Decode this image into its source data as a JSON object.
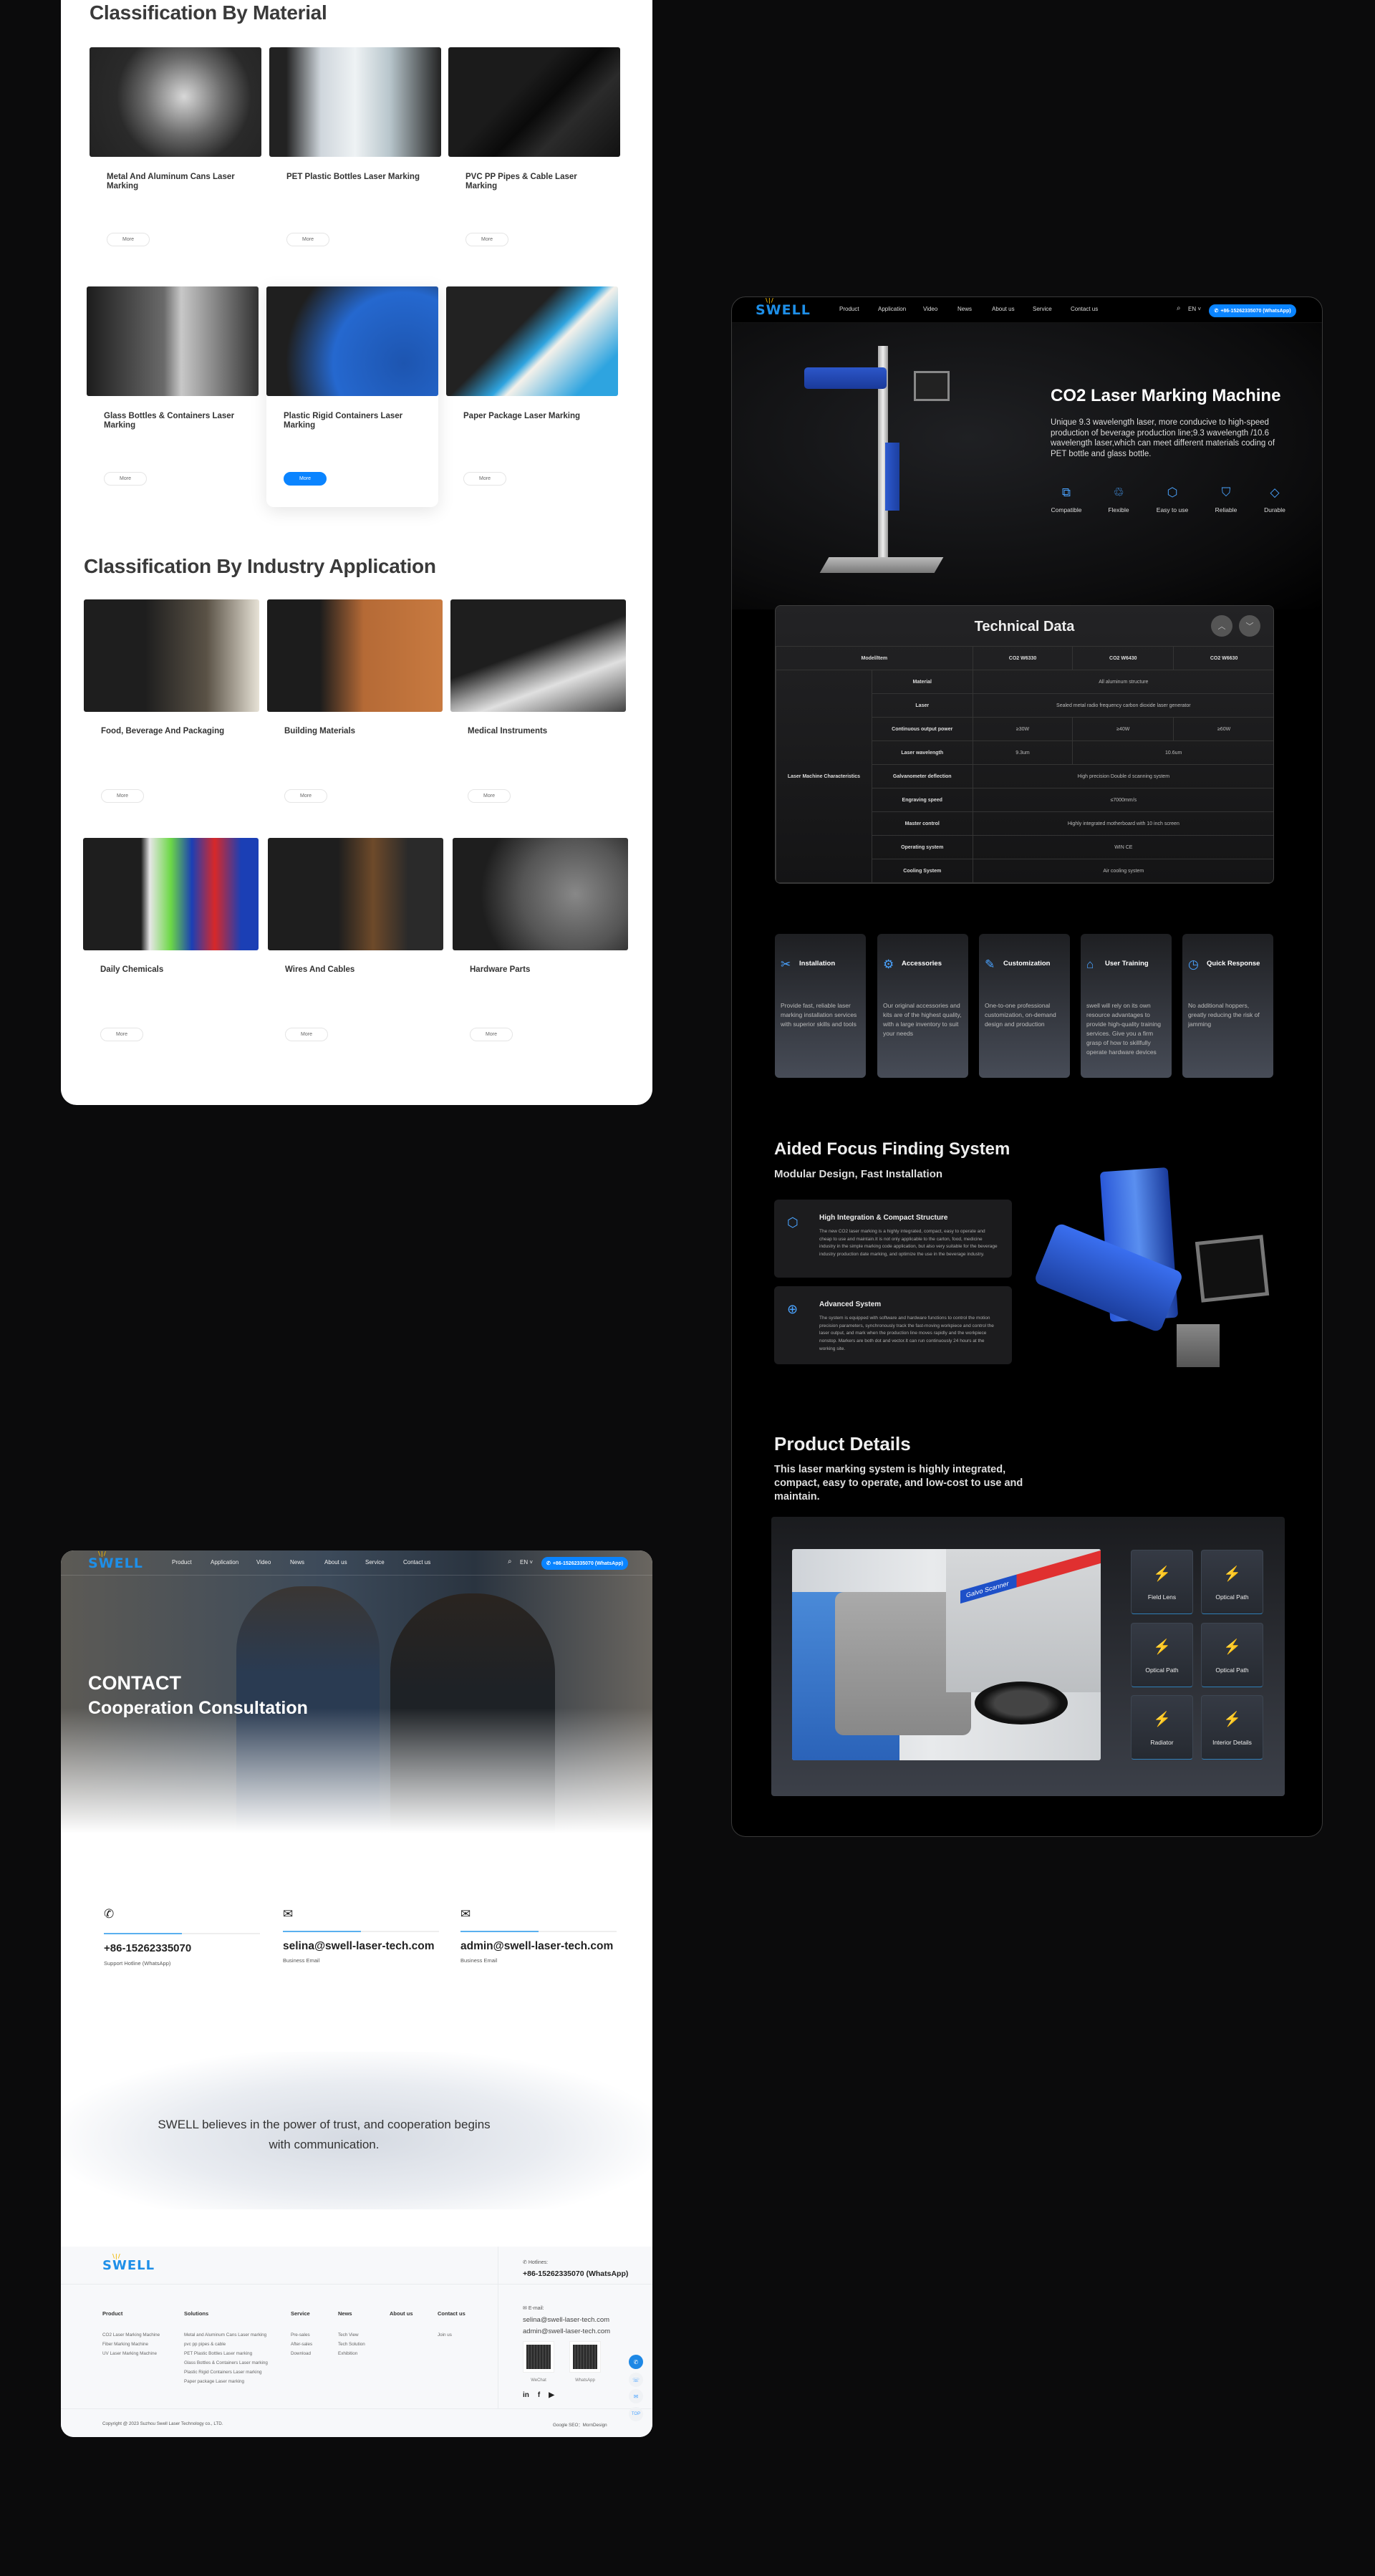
{
  "material": {
    "title": "Classification By Material",
    "cards": [
      {
        "title": "Metal And Aluminum Cans Laser Marking",
        "more": "More"
      },
      {
        "title": "PET Plastic Bottles Laser Marking",
        "more": "More"
      },
      {
        "title": "PVC PP Pipes & Cable Laser Marking",
        "more": "More"
      },
      {
        "title": "Glass Bottles & Containers Laser Marking",
        "more": "More"
      },
      {
        "title": "Plastic Rigid Containers Laser Marking",
        "more": "More",
        "active": true
      },
      {
        "title": "Paper Package Laser Marking",
        "more": "More"
      }
    ]
  },
  "industry": {
    "title": "Classification By Industry Application",
    "cards": [
      {
        "title": "Food, Beverage And Packaging",
        "more": "More"
      },
      {
        "title": "Building Materials",
        "more": "More"
      },
      {
        "title": "Medical Instruments",
        "more": "More"
      },
      {
        "title": "Daily Chemicals",
        "more": "More"
      },
      {
        "title": "Wires And Cables",
        "more": "More"
      },
      {
        "title": "Hardware Parts",
        "more": "More"
      }
    ]
  },
  "nav": {
    "logo": "SWELL",
    "items": [
      "Product",
      "Application",
      "Video",
      "News",
      "About us",
      "Service",
      "Contact us"
    ],
    "lang": "EN",
    "whatsapp": "+86-15262335070 (WhatsApp)",
    "accent": "#0a84ff"
  },
  "hero": {
    "title": "CO2 Laser Marking Machine",
    "description": "Unique 9.3 wavelength laser, more conducive to high-speed production of beverage production line;9.3 wavelength /10.6 wavelength laser,which can meet different materials coding of PET bottle and glass bottle.",
    "features": [
      {
        "label": "Compatible",
        "icon": "compatible-icon"
      },
      {
        "label": "Flexible",
        "icon": "flexible-icon"
      },
      {
        "label": "Easy to use",
        "icon": "cube-icon"
      },
      {
        "label": "Reliable",
        "icon": "shield-icon"
      },
      {
        "label": "Durable",
        "icon": "diamond-icon"
      }
    ]
  },
  "tech": {
    "title": "Technical Data",
    "header": [
      "Model/Item",
      "CO2 W6330",
      "CO2 W6430",
      "CO2 W6630"
    ],
    "group": "Laser Machine Characteristics",
    "rows": [
      {
        "item": "Material",
        "values": [
          "All aluminum structure"
        ]
      },
      {
        "item": "Laser",
        "values": [
          "Sealed metal radio frequency carbon dioxide laser generator"
        ]
      },
      {
        "item": "Continuous output power",
        "values": [
          "≥30W",
          "≥40W",
          "≥60W"
        ]
      },
      {
        "item": "Laser wavelength",
        "values": [
          "9.3um",
          "10.6um"
        ]
      },
      {
        "item": "Galvanometer deflection",
        "values": [
          "High precision Double d scanning system"
        ]
      },
      {
        "item": "Engraving speed",
        "values": [
          "≤7000mm/s"
        ]
      },
      {
        "item": "Master control",
        "values": [
          "Highly integrated motherboard with 10 inch screen"
        ]
      },
      {
        "item": "Operating system",
        "values": [
          "WIN CE"
        ]
      },
      {
        "item": "Cooling System",
        "values": [
          "Air cooling system"
        ]
      }
    ]
  },
  "services": [
    {
      "title": "Installation",
      "icon": "tools-icon",
      "desc": "Provide fast, reliable laser marking installation services with superior skills and tools"
    },
    {
      "title": "Accessories",
      "icon": "gear-icon",
      "desc": "Our original accessories and kits are of the highest quality, with a large inventory to suit your needs"
    },
    {
      "title": "Customization",
      "icon": "pencil-ruler-icon",
      "desc": "One-to-one professional customization, on-demand design and production"
    },
    {
      "title": "User Training",
      "icon": "training-icon",
      "desc": "swell will rely on its own resource advantages to provide high-quality training services. Give you a firm grasp of how to skillfully operate hardware devices"
    },
    {
      "title": "Quick Response",
      "icon": "clock-icon",
      "desc": "No additional hoppers, greatly reducing the risk of jamming"
    }
  ],
  "focus": {
    "title": "Aided Focus Finding System",
    "subtitle": "Modular Design, Fast Installation",
    "boxes": [
      {
        "title": "High Integration & Compact Structure",
        "icon": "cube-icon",
        "desc": "The new CO2 laser marking is a highly integrated, compact, easy to operate and cheap to use and maintain.It is not only applicable to the carton, food, medicine industry in the simple marking code application, but also very suitable for the beverage industry production date marking, and optimize the use in the beverage industry."
      },
      {
        "title": "Advanced System",
        "icon": "target-icon",
        "desc": "The system is equipped with software and hardware functions to control the motion precision parameters, synchronously track the fast-moving workpiece and control the laser output, and mark when the production line moves rapidly and the workpiece nonstop. Markers are both dot and vector.It can run continuously 24 hours at the working site."
      }
    ]
  },
  "details": {
    "title": "Product Details",
    "subtitle": "This laser marking system is highly integrated, compact, easy to operate, and low-cost to use and maintain.",
    "photo_label": "Galvo Scanner",
    "tiles": [
      "Field Lens",
      "Optical Path",
      "Optical Path",
      "Optical Path",
      "Radiator",
      "Interior Details"
    ]
  },
  "contact": {
    "title": "CONTACT",
    "subtitle": "Cooperation Consultation",
    "items": [
      {
        "value": "+86-15262335070",
        "label": "Support Hotline (WhatsApp)",
        "icon": "phone-icon"
      },
      {
        "value": "selina@swell-laser-tech.com",
        "label": "Business Email",
        "icon": "mail-icon"
      },
      {
        "value": "admin@swell-laser-tech.com",
        "label": "Business Email",
        "icon": "mail-icon"
      }
    ],
    "quote": "SWELL believes in the power of trust, and cooperation begins with communication."
  },
  "footer": {
    "columns": [
      {
        "heading": "Product",
        "links": [
          "CO2 Laser Marking Machine",
          "Fiber Marking Machine",
          "UV Laser Marking Machine"
        ]
      },
      {
        "heading": "Solutions",
        "links": [
          "Metal and Aluminum Cans Laser marking",
          "pvc pp pipes & cable",
          "PET Plastic Bottles Laser marking",
          "Glass Bottles & Containers Laser marking",
          "Plastic Rigid Containers Laser marking",
          "Paper package Laser marking"
        ]
      },
      {
        "heading": "Service",
        "links": [
          "Pre-sales",
          "After-sales",
          "Download"
        ]
      },
      {
        "heading": "News",
        "links": [
          "Tech View",
          "Tech Solution",
          "Exhibition"
        ]
      },
      {
        "heading": "About us",
        "links": []
      },
      {
        "heading": "Contact us",
        "links": [
          "Join us"
        ]
      }
    ],
    "hotline_label": "Hotlines:",
    "hotline": "+86-15262335070 (WhatsApp)",
    "email_label": "E-mail:",
    "emails": [
      "selina@swell-laser-tech.com",
      "admin@swell-laser-tech.com"
    ],
    "qr_labels": [
      "WeChat",
      "WhatsApp"
    ],
    "social": [
      "linkedin-icon",
      "facebook-icon",
      "youtube-icon"
    ],
    "copyright": "Copyright @ 2023 Suzhou Swell Laser Technology co., LTD.",
    "credit": "Google SEO：MornDesign",
    "top_label": "TOP"
  }
}
